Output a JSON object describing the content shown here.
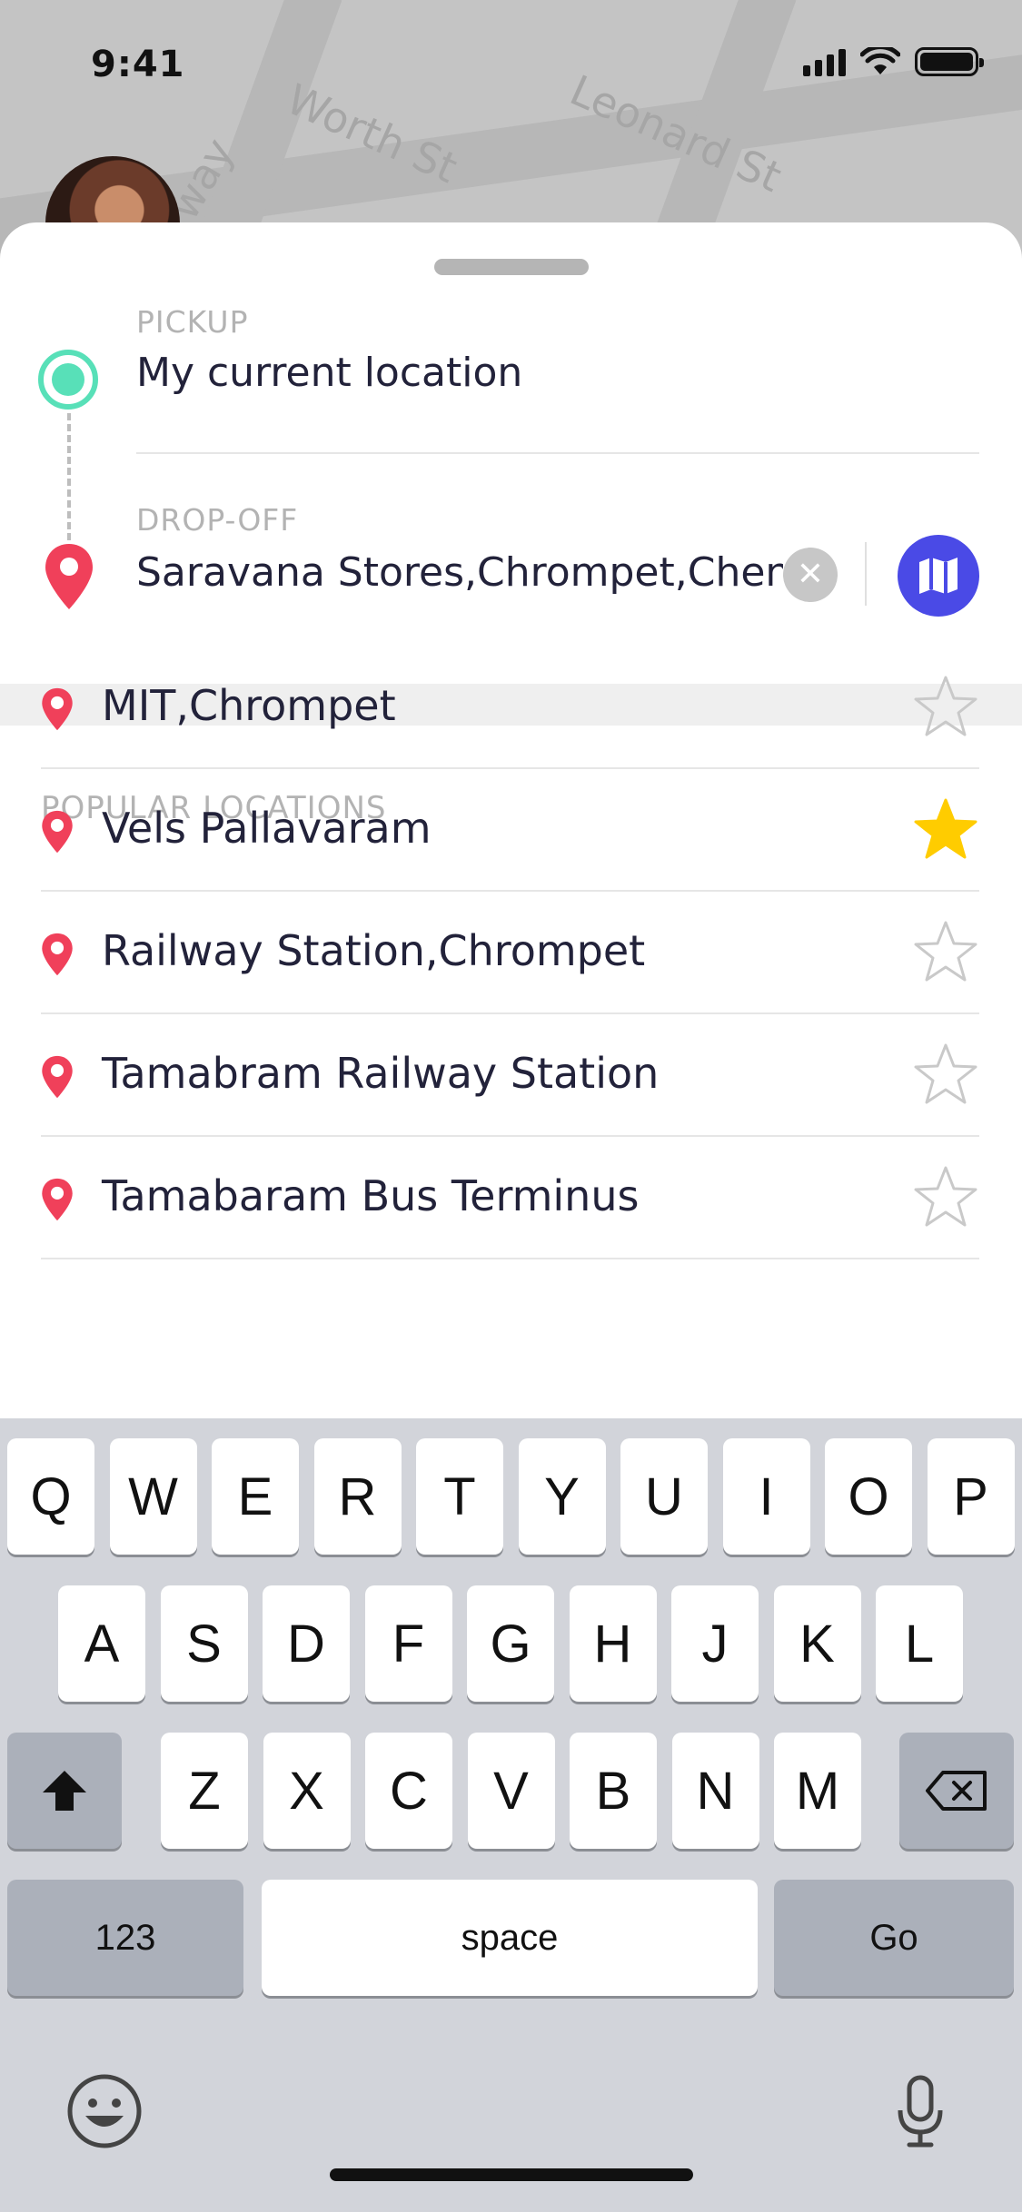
{
  "status_bar": {
    "time": "9:41"
  },
  "map": {
    "street_labels": [
      "Worth St",
      "Leonard St",
      "way"
    ]
  },
  "trip": {
    "pickup_label": "PICKUP",
    "pickup_value": "My current location",
    "dropoff_label": "DROP-OFF",
    "dropoff_value": "Saravana Stores,Chrompet,Chennai",
    "clear_symbol": "✕"
  },
  "popular": {
    "title": "POPULAR LOCATIONS",
    "items": [
      {
        "name": "MIT,Chrompet",
        "favorite": false
      },
      {
        "name": "Vels Pallavaram",
        "favorite": true
      },
      {
        "name": "Railway Station,Chrompet",
        "favorite": false
      },
      {
        "name": "Tamabram Railway Station",
        "favorite": false
      },
      {
        "name": "Tamabaram Bus Terminus",
        "favorite": false
      }
    ]
  },
  "keyboard": {
    "row1": [
      "Q",
      "W",
      "E",
      "R",
      "T",
      "Y",
      "U",
      "I",
      "O",
      "P"
    ],
    "row2": [
      "A",
      "S",
      "D",
      "F",
      "G",
      "H",
      "J",
      "K",
      "L"
    ],
    "row3": [
      "Z",
      "X",
      "C",
      "V",
      "B",
      "N",
      "M"
    ],
    "numbers_label": "123",
    "space_label": "space",
    "go_label": "Go"
  },
  "colors": {
    "pickup_accent": "#58e0b8",
    "pin_red": "#f0405a",
    "map_button": "#4a4ae6",
    "star_favorite": "#ffcc00",
    "text_primary": "#22223a"
  },
  "icons": [
    "signal-icon",
    "wifi-icon",
    "battery-icon",
    "location-pin-icon",
    "map-icon",
    "star-icon",
    "shift-icon",
    "backspace-icon",
    "emoji-icon",
    "microphone-icon"
  ]
}
